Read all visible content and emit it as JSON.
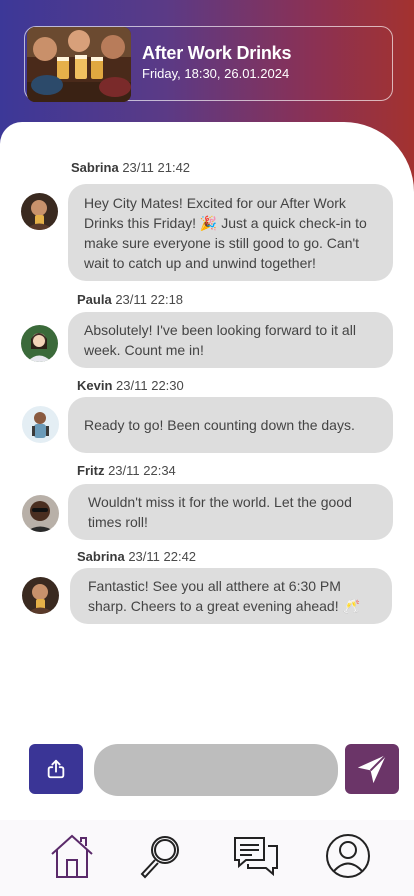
{
  "event": {
    "title": "After Work Drinks",
    "datetime": "Friday, 18:30, 26.01.2024"
  },
  "messages": [
    {
      "author": "Sabrina",
      "time": "23/11 21:42",
      "text": "Hey City Mates! Excited for our After Work Drinks this Friday! 🎉 Just a quick check-in to make sure everyone is still good to go. Can't wait to catch up and unwind together!"
    },
    {
      "author": "Paula",
      "time": "23/11 22:18",
      "text": "Absolutely! I've been looking forward to it all week. Count me in!"
    },
    {
      "author": "Kevin",
      "time": "23/11 22:30",
      "text": "Ready to go! Been counting down the days."
    },
    {
      "author": "Fritz",
      "time": "23/11 22:34",
      "text": "Wouldn't miss it for the world. Let the good times roll!"
    },
    {
      "author": "Sabrina",
      "time": "23/11 22:42",
      "text": "Fantastic! See you all atthere at 6:30 PM sharp. Cheers to a great evening ahead! 🥂"
    }
  ],
  "composer": {
    "placeholder": ""
  },
  "nav": {
    "items": [
      {
        "icon": "home-icon"
      },
      {
        "icon": "search-icon"
      },
      {
        "icon": "chat-icon"
      },
      {
        "icon": "profile-icon"
      }
    ]
  },
  "colors": {
    "gradient_start": "#3c3898",
    "gradient_end": "#a3322f",
    "share_button": "#3a3596",
    "send_button": "#6b3568",
    "bubble": "#dddddd"
  }
}
